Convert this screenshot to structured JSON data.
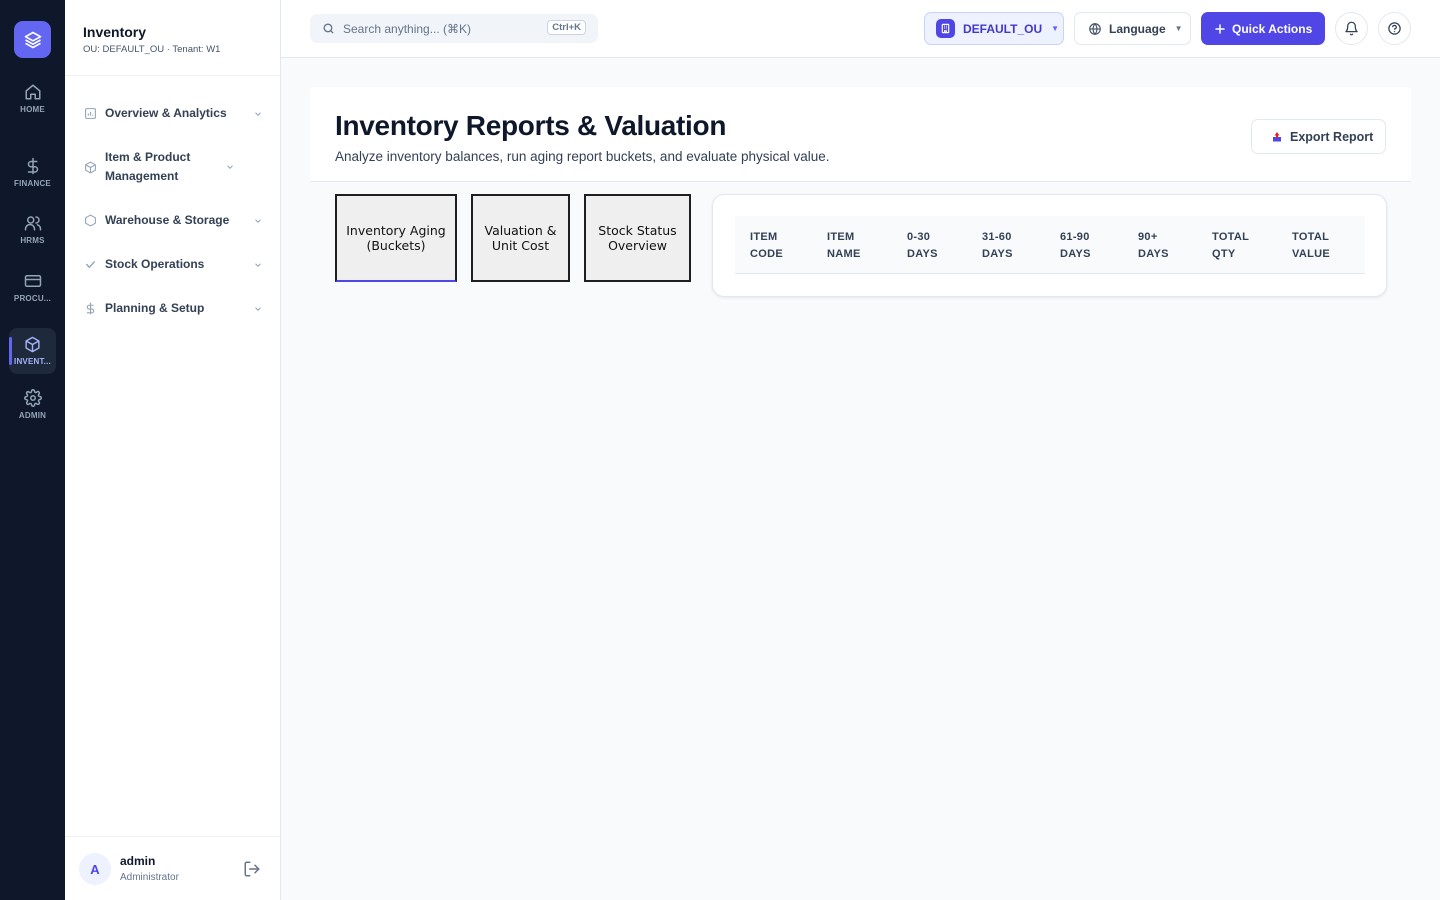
{
  "rail": {
    "items": [
      {
        "label": "HOME",
        "icon": "home-icon"
      },
      {
        "label": "FINANCE",
        "icon": "dollar-icon"
      },
      {
        "label": "HRMS",
        "icon": "users-icon"
      },
      {
        "label": "PROCU...",
        "icon": "card-icon"
      },
      {
        "label": "INVENT...",
        "icon": "box-icon",
        "active": true
      },
      {
        "label": "ADMIN",
        "icon": "gear-icon"
      }
    ]
  },
  "sidebar": {
    "title": "Inventory",
    "subtitle": "OU: DEFAULT_OU · Tenant: W1",
    "items": [
      {
        "label": "Overview & Analytics"
      },
      {
        "label": "Item & Product Management"
      },
      {
        "label": "Warehouse & Storage"
      },
      {
        "label": "Stock Operations"
      },
      {
        "label": "Planning & Setup"
      }
    ],
    "user": {
      "initial": "A",
      "name": "admin",
      "role": "Administrator"
    }
  },
  "topbar": {
    "search_placeholder": "Search anything... (⌘K)",
    "search_shortcut": "Ctrl+K",
    "ou_label": "DEFAULT_OU",
    "language_label": "Language",
    "quick_actions_label": "Quick Actions"
  },
  "page": {
    "title": "Inventory Reports & Valuation",
    "subtitle": "Analyze inventory balances, run aging report buckets, and evaluate physical value.",
    "export_label": "Export Report"
  },
  "tabs": [
    {
      "label": "Inventory Aging (Buckets)",
      "active": true
    },
    {
      "label": "Valuation & Unit Cost"
    },
    {
      "label": "Stock Status Overview"
    }
  ],
  "table": {
    "columns": [
      "ITEM CODE",
      "ITEM NAME",
      "0-30 DAYS",
      "31-60 DAYS",
      "61-90 DAYS",
      "90+ DAYS",
      "TOTAL QTY",
      "TOTAL VALUE"
    ],
    "rows": []
  },
  "colors": {
    "accent": "#4f46e5",
    "rail_bg": "#0f172a",
    "page_bg": "#f8fafc"
  }
}
